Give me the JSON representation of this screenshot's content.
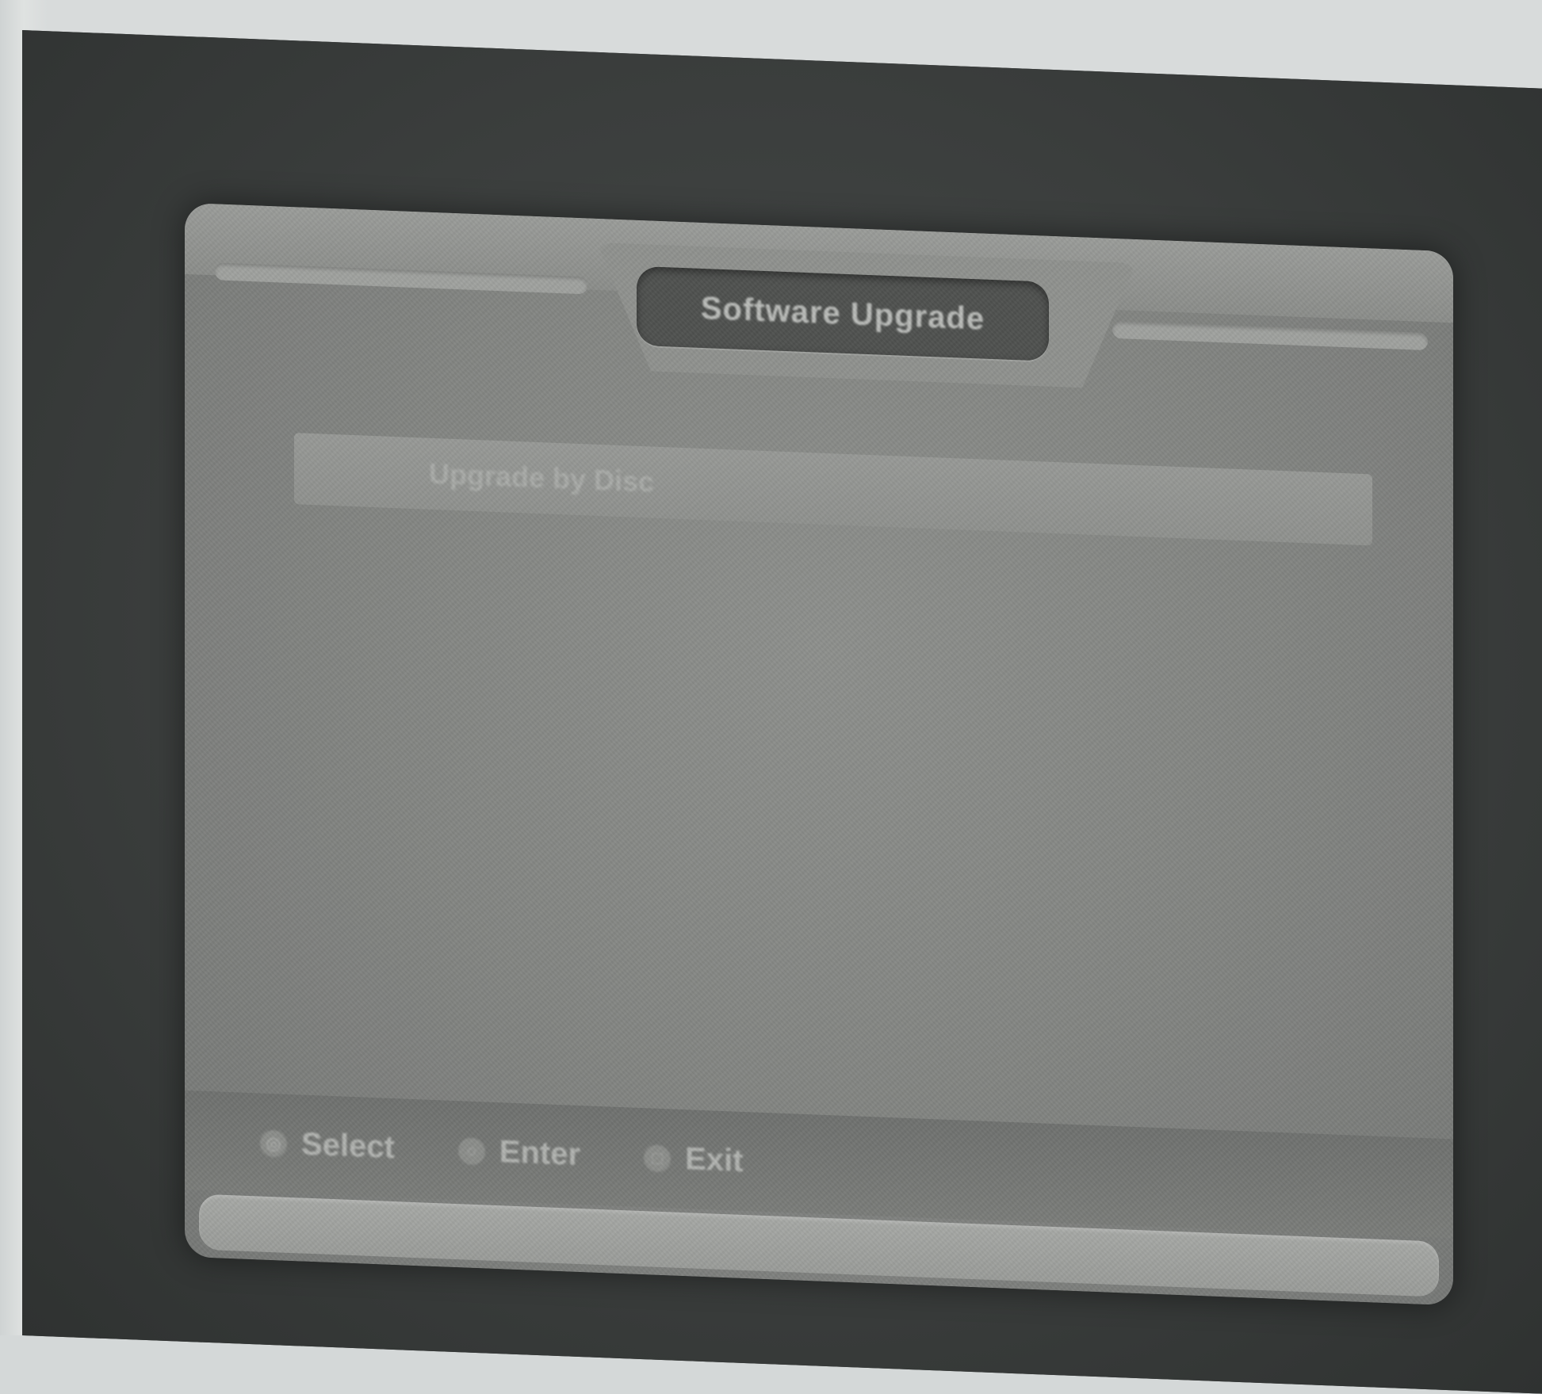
{
  "window": {
    "title": "Software Upgrade"
  },
  "menu": {
    "selected_item": "Upgrade by Disc"
  },
  "footer": {
    "hints": [
      {
        "button_glyph": "◎",
        "label": "Select"
      },
      {
        "button_glyph": "○",
        "label": "Enter"
      },
      {
        "button_glyph": "□",
        "label": "Exit"
      }
    ]
  },
  "colors": {
    "screen_background": "#838583",
    "title_plate": "#4f514f",
    "footer_bar": "#747673",
    "bezel": "#3a3d3c"
  }
}
